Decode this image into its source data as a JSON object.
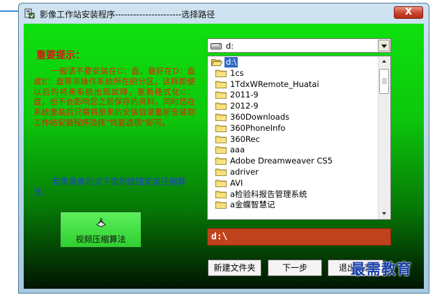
{
  "window": {
    "title": "影像工作站安装程序----------------------选择路径",
    "close_label": "X"
  },
  "notice": {
    "heading": "重要提示：",
    "body": "一般请不要安装在C：盘，最好在D：盘或E：盘等非操作系统所在的分区，这样即使以后的将来系统出现故障，重新格式化C：盘，也不会影响您之前保存的资料，同时您在系统重装后只需将原来的安装目录重新安装到工作站安装程序选择“恢复选项”即可。",
    "compress_note": "若需录像可点下面的按钮安装压缩算法："
  },
  "compress_button": {
    "label": "视频压缩算法",
    "icon": "compress-tool-icon"
  },
  "drive_select": {
    "value": "d:",
    "icon": "drive-icon"
  },
  "dir_list": {
    "items": [
      {
        "label": "d:\\",
        "icon": "open-folder-icon",
        "selected": true,
        "indent": 0
      },
      {
        "label": "1cs",
        "icon": "folder-icon",
        "selected": false,
        "indent": 1
      },
      {
        "label": "1TdxWRemote_Huatai",
        "icon": "folder-icon",
        "selected": false,
        "indent": 1
      },
      {
        "label": "2011-9",
        "icon": "folder-icon",
        "selected": false,
        "indent": 1
      },
      {
        "label": "2012-9",
        "icon": "folder-icon",
        "selected": false,
        "indent": 1
      },
      {
        "label": "360Downloads",
        "icon": "folder-icon",
        "selected": false,
        "indent": 1
      },
      {
        "label": "360PhoneInfo",
        "icon": "folder-icon",
        "selected": false,
        "indent": 1
      },
      {
        "label": "360Rec",
        "icon": "folder-icon",
        "selected": false,
        "indent": 1
      },
      {
        "label": "aaa",
        "icon": "folder-icon",
        "selected": false,
        "indent": 1
      },
      {
        "label": "Adobe Dreamweaver CS5",
        "icon": "folder-icon",
        "selected": false,
        "indent": 1
      },
      {
        "label": "adriver",
        "icon": "folder-icon",
        "selected": false,
        "indent": 1
      },
      {
        "label": "AVI",
        "icon": "folder-icon",
        "selected": false,
        "indent": 1
      },
      {
        "label": "a检验科报告管理系统",
        "icon": "folder-icon",
        "selected": false,
        "indent": 1
      },
      {
        "label": "a金蝶智慧记",
        "icon": "folder-icon",
        "selected": false,
        "indent": 1
      }
    ]
  },
  "current_path": "d:\\",
  "buttons": {
    "new_folder": "新建文件夹",
    "next": "下一步",
    "exit": "退出安装"
  },
  "watermark": "最需教育",
  "colors": {
    "heading_red": "#d81414",
    "notice_red": "#e61e0a",
    "compress_blue": "#1f3fcf",
    "path_bg": "#c0421c",
    "selection": "#316ac5",
    "watermark": "#1a3fa8"
  }
}
